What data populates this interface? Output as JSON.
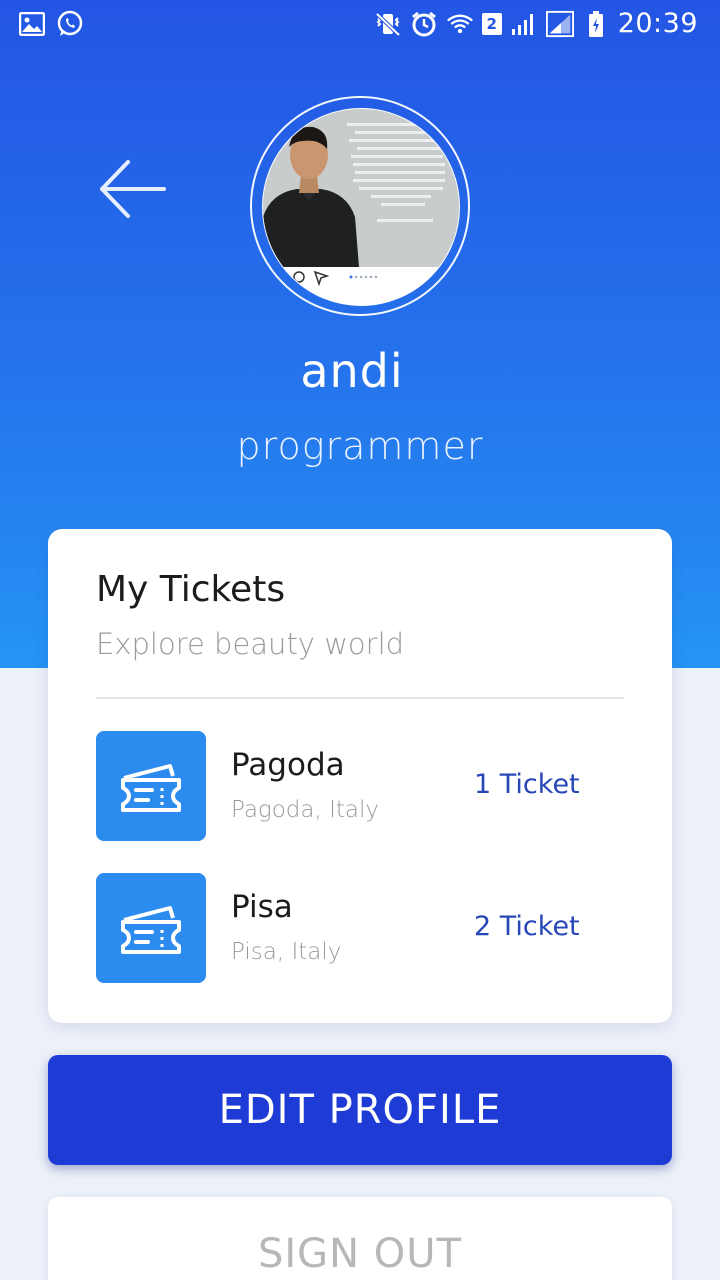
{
  "status_bar": {
    "time": "20:39",
    "sim_badge": "2",
    "icons": [
      "gallery-icon",
      "whatsapp-icon",
      "vibrate-icon",
      "alarm-icon",
      "wifi-icon",
      "signal-icon",
      "signal-icon",
      "battery-icon"
    ]
  },
  "profile": {
    "name": "andi",
    "role": "programmer",
    "back_icon": "back-arrow-icon"
  },
  "tickets_card": {
    "title": "My Tickets",
    "subtitle": "Explore beauty world",
    "items": [
      {
        "name": "Pagoda",
        "location": "Pagoda, Italy",
        "count": "1 Ticket",
        "icon": "ticket-icon"
      },
      {
        "name": "Pisa",
        "location": "Pisa, Italy",
        "count": "2 Ticket",
        "icon": "ticket-icon"
      }
    ]
  },
  "actions": {
    "edit_profile": "EDIT PROFILE",
    "sign_out": "SIGN OUT"
  },
  "colors": {
    "header_gradient_top": "#2355E4",
    "header_gradient_bottom": "#2594F4",
    "primary_button": "#1F3BD6",
    "ticket_icon_bg": "#2B8BEE",
    "ticket_count_text": "#2746B8",
    "page_background": "#ECF0F8"
  }
}
